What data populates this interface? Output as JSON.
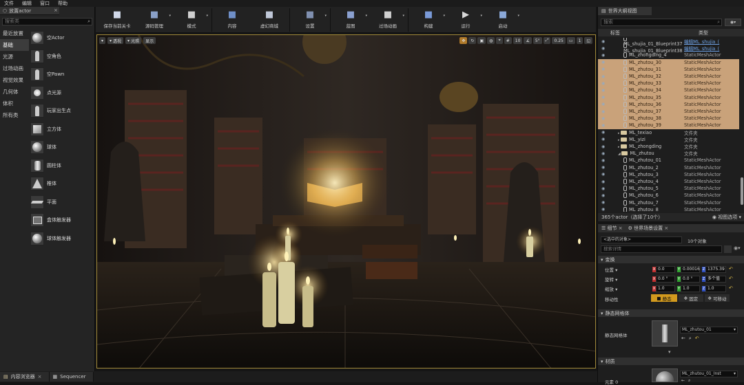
{
  "menu": [
    "文件",
    "编辑",
    "窗口",
    "帮助"
  ],
  "left_panel": {
    "tab_label": "放置actor",
    "search_placeholder": "搜索类",
    "categories": [
      {
        "label": "最近放置",
        "selected": false
      },
      {
        "label": "基础",
        "selected": true
      },
      {
        "label": "光源",
        "selected": false
      },
      {
        "label": "过场动画",
        "selected": false
      },
      {
        "label": "视觉效果",
        "selected": false
      },
      {
        "label": "几何体",
        "selected": false
      },
      {
        "label": "体积",
        "selected": false
      },
      {
        "label": "所有类",
        "selected": false
      }
    ],
    "items": [
      {
        "label": "空Actor",
        "icon": "sphere-icon"
      },
      {
        "label": "空角色",
        "icon": "character-icon"
      },
      {
        "label": "空Pawn",
        "icon": "pawn-icon"
      },
      {
        "label": "点光源",
        "icon": "point-light-icon"
      },
      {
        "label": "玩家出生点",
        "icon": "player-start-icon"
      },
      {
        "label": "立方体",
        "icon": "cube-icon"
      },
      {
        "label": "球体",
        "icon": "sphere-icon"
      },
      {
        "label": "圆柱体",
        "icon": "cylinder-icon"
      },
      {
        "label": "椎体",
        "icon": "cone-icon"
      },
      {
        "label": "平面",
        "icon": "plane-icon"
      },
      {
        "label": "盒体触发器",
        "icon": "box-trigger-icon"
      },
      {
        "label": "球体触发器",
        "icon": "sphere-trigger-icon"
      }
    ]
  },
  "toolbar": {
    "buttons": [
      {
        "label": "保存当前关卡",
        "icon": "save-icon",
        "color": "#d0d8e8",
        "dropdown": false
      },
      {
        "label": "源码管理",
        "icon": "source-control-icon",
        "color": "#8aa0c8",
        "dropdown": true
      },
      {
        "label": "模式",
        "icon": "modes-icon",
        "color": "#d0d0d0",
        "dropdown": true
      },
      {
        "label": "内容",
        "icon": "content-icon",
        "color": "#6f8fc8",
        "dropdown": false
      },
      {
        "label": "虚幻商城",
        "icon": "marketplace-icon",
        "color": "#c0c8d8",
        "dropdown": false
      },
      {
        "label": "设置",
        "icon": "settings-icon",
        "color": "#8090b0",
        "dropdown": true
      },
      {
        "label": "蓝图",
        "icon": "blueprint-icon",
        "color": "#8aa0d0",
        "dropdown": true
      },
      {
        "label": "过场动画",
        "icon": "cinematics-icon",
        "color": "#d0d0d0",
        "dropdown": true
      },
      {
        "label": "构建",
        "icon": "build-icon",
        "color": "#7a9ad8",
        "dropdown": true
      },
      {
        "label": "运行",
        "icon": "play-icon",
        "color": "#d8d8d8",
        "dropdown": true
      },
      {
        "label": "启动",
        "icon": "launch-icon",
        "color": "#8aa8d8",
        "dropdown": true
      }
    ]
  },
  "viewport": {
    "left_buttons": [
      "透视",
      "光照",
      "显示"
    ],
    "right_values": [
      "10",
      "5°",
      "0.25",
      "1"
    ]
  },
  "outliner": {
    "tab_label": "世界大纲视图",
    "search_placeholder": "搜索",
    "col_label": "标签",
    "col_type": "类型",
    "rows": [
      {
        "name": "ML_shujia_01_Blueprint37",
        "type": "编辑ML_shujia_(",
        "kind": "mesh",
        "selected": false,
        "link": true,
        "indent": 0
      },
      {
        "name": "ML_shujia_01_Blueprint38",
        "type": "编辑ML_shujia_(",
        "kind": "mesh",
        "selected": false,
        "link": true,
        "indent": 0
      },
      {
        "name": "ML_zhongding_4",
        "type": "StaticMeshActor",
        "kind": "mesh",
        "selected": false,
        "link": false,
        "indent": 0
      },
      {
        "name": "ML_zhutou_30",
        "type": "StaticMeshActor",
        "kind": "mesh",
        "selected": true,
        "link": false,
        "indent": 0
      },
      {
        "name": "ML_zhutou_31",
        "type": "StaticMeshActor",
        "kind": "mesh",
        "selected": true,
        "link": false,
        "indent": 0
      },
      {
        "name": "ML_zhutou_32",
        "type": "StaticMeshActor",
        "kind": "mesh",
        "selected": true,
        "link": false,
        "indent": 0
      },
      {
        "name": "ML_zhutou_33",
        "type": "StaticMeshActor",
        "kind": "mesh",
        "selected": true,
        "link": false,
        "indent": 0
      },
      {
        "name": "ML_zhutou_34",
        "type": "StaticMeshActor",
        "kind": "mesh",
        "selected": true,
        "link": false,
        "indent": 0
      },
      {
        "name": "ML_zhutou_35",
        "type": "StaticMeshActor",
        "kind": "mesh",
        "selected": true,
        "link": false,
        "indent": 0
      },
      {
        "name": "ML_zhutou_36",
        "type": "StaticMeshActor",
        "kind": "mesh",
        "selected": true,
        "link": false,
        "indent": 0
      },
      {
        "name": "ML_zhutou_37",
        "type": "StaticMeshActor",
        "kind": "mesh",
        "selected": true,
        "link": false,
        "indent": 0
      },
      {
        "name": "ML_zhutou_38",
        "type": "StaticMeshActor",
        "kind": "mesh",
        "selected": true,
        "link": false,
        "indent": 0
      },
      {
        "name": "ML_zhutou_39",
        "type": "StaticMeshActor",
        "kind": "mesh",
        "selected": true,
        "link": false,
        "indent": 0
      },
      {
        "name": "ML_texiao",
        "type": "文件夹",
        "kind": "folder",
        "selected": false,
        "link": false,
        "indent": 0
      },
      {
        "name": "ML_yizi",
        "type": "文件夹",
        "kind": "folder",
        "selected": false,
        "link": false,
        "indent": 0
      },
      {
        "name": "ML_zhongding",
        "type": "文件夹",
        "kind": "folder",
        "selected": false,
        "link": false,
        "indent": 0
      },
      {
        "name": "ML_zhutou",
        "type": "文件夹",
        "kind": "folder-open",
        "selected": false,
        "link": false,
        "indent": 0
      },
      {
        "name": "ML_zhutou_01",
        "type": "StaticMeshActor",
        "kind": "mesh",
        "selected": false,
        "link": false,
        "indent": 0
      },
      {
        "name": "ML_zhutou_2",
        "type": "StaticMeshActor",
        "kind": "mesh",
        "selected": false,
        "link": false,
        "indent": 0
      },
      {
        "name": "ML_zhutou_3",
        "type": "StaticMeshActor",
        "kind": "mesh",
        "selected": false,
        "link": false,
        "indent": 0
      },
      {
        "name": "ML_zhutou_4",
        "type": "StaticMeshActor",
        "kind": "mesh",
        "selected": false,
        "link": false,
        "indent": 0
      },
      {
        "name": "ML_zhutou_5",
        "type": "StaticMeshActor",
        "kind": "mesh",
        "selected": false,
        "link": false,
        "indent": 0
      },
      {
        "name": "ML_zhutou_6",
        "type": "StaticMeshActor",
        "kind": "mesh",
        "selected": false,
        "link": false,
        "indent": 0
      },
      {
        "name": "ML_zhutou_7",
        "type": "StaticMeshActor",
        "kind": "mesh",
        "selected": false,
        "link": false,
        "indent": 0
      },
      {
        "name": "ML_zhutou_8",
        "type": "StaticMeshActor",
        "kind": "mesh",
        "selected": false,
        "link": false,
        "indent": 0
      }
    ],
    "footer_count": "365个actor（选择了10个）",
    "view_options": "视图选项"
  },
  "details": {
    "tab_details": "细节",
    "tab_world": "世界场景设置",
    "selected_dropdown": "<选中的对象>",
    "selected_count": "10个对象",
    "search_placeholder": "搜索详情",
    "transform_section": "变换",
    "location_label": "位置",
    "rotation_label": "旋转",
    "scale_label": "缩放",
    "mobility_label": "移动性",
    "location": [
      "0.0",
      "0.00016",
      "1375.39"
    ],
    "rotation": [
      "0.0 °",
      "0.0 °",
      "多个值"
    ],
    "scale": [
      "1.0",
      "1.0",
      "1.0"
    ],
    "mobility": [
      "静态",
      "固定",
      "可移动"
    ],
    "static_mesh_section": "静态网格体",
    "static_mesh_label": "静态网格体",
    "static_mesh_value": "ML_zhutou_01",
    "materials_section": "材质",
    "element_label": "元素 0",
    "material_value": "ML_zhutou_01_Inst"
  },
  "bottom_tabs": [
    "内容浏览器",
    "Sequencer"
  ]
}
